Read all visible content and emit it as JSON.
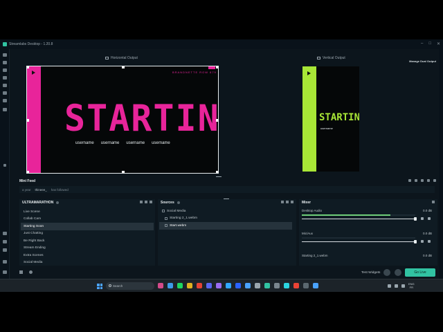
{
  "window": {
    "title": "Streamlabs Desktop - 1.20.8"
  },
  "preview": {
    "horizontal_label": "Horizontal Output",
    "vertical_label": "Vertical Output",
    "manage_dual_output": "Manage Dual Output",
    "horizontal_scene": {
      "headline": "STARTING",
      "top_text": "BRANDNETTE ROW 879",
      "usernames": [
        "username",
        "username",
        "username",
        "username"
      ]
    },
    "vertical_scene": {
      "headline": "STARTING",
      "username": "username"
    },
    "accent_pink": "#e8249a",
    "accent_green": "#a8e636"
  },
  "mini_feed": {
    "title": "Mini Feed",
    "event": {
      "time": "a year",
      "name": "thineee_",
      "action": "has followed"
    }
  },
  "scenes": {
    "title": "ULTRAMARATHON",
    "items": [
      "Live Scene",
      "Collab Cam",
      "Starting Soon",
      "Just Chatting",
      "Be Right Back",
      "Stream Ending",
      "Extra Scenes",
      "Social Media"
    ],
    "active_index": 2
  },
  "sources": {
    "title": "Sources",
    "items": [
      "Social Media",
      "Starting 2_1.webm",
      "Start.webm"
    ],
    "active_index": 2
  },
  "mixer": {
    "title": "Mixer",
    "channels": [
      {
        "name": "Desktop Audio",
        "db": "0.0 dB",
        "level": 0.78
      },
      {
        "name": "Mic/Aux",
        "db": "0.0 dB",
        "level": 0.0
      },
      {
        "name": "Starting 2_1.webm",
        "db": "0.0 dB",
        "level": 0.0
      }
    ]
  },
  "bottom": {
    "test_widgets": "Test Widgets",
    "go_live": "Go Live",
    "go_live_color": "#31c3a2"
  },
  "taskbar": {
    "search_placeholder": "Search",
    "clock_top": "ENG",
    "clock_bottom": "FR"
  }
}
